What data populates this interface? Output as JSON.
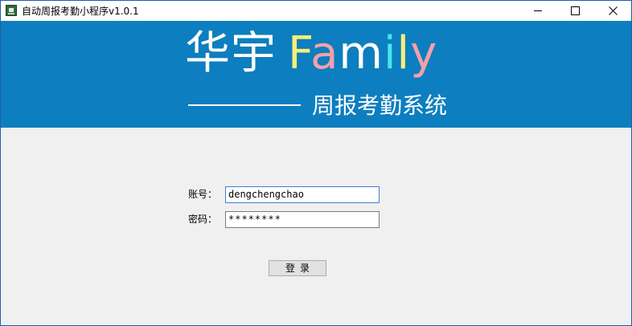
{
  "window": {
    "title": "自动周报考勤小程序v1.0.1"
  },
  "banner": {
    "brand_cn": "华宇",
    "brand_letters": [
      {
        "char": "F",
        "color": "#f6f078"
      },
      {
        "char": "a",
        "color": "#f4a0a8"
      },
      {
        "char": "m",
        "color": "#ffffff"
      },
      {
        "char": "i",
        "color": "#47e6e8"
      },
      {
        "char": "l",
        "color": "#f6f078"
      },
      {
        "char": "y",
        "color": "#f4a0a8"
      }
    ],
    "subtitle": "周报考勤系统",
    "background_color": "#0d7ebf"
  },
  "form": {
    "account_label": "账号：",
    "account_value": "dengchengchao",
    "password_label": "密码：",
    "password_value": "********",
    "login_button_label": "登录"
  },
  "icons": {
    "app": "app-icon",
    "minimize": "minimize-icon",
    "maximize": "maximize-icon",
    "close": "close-icon"
  }
}
